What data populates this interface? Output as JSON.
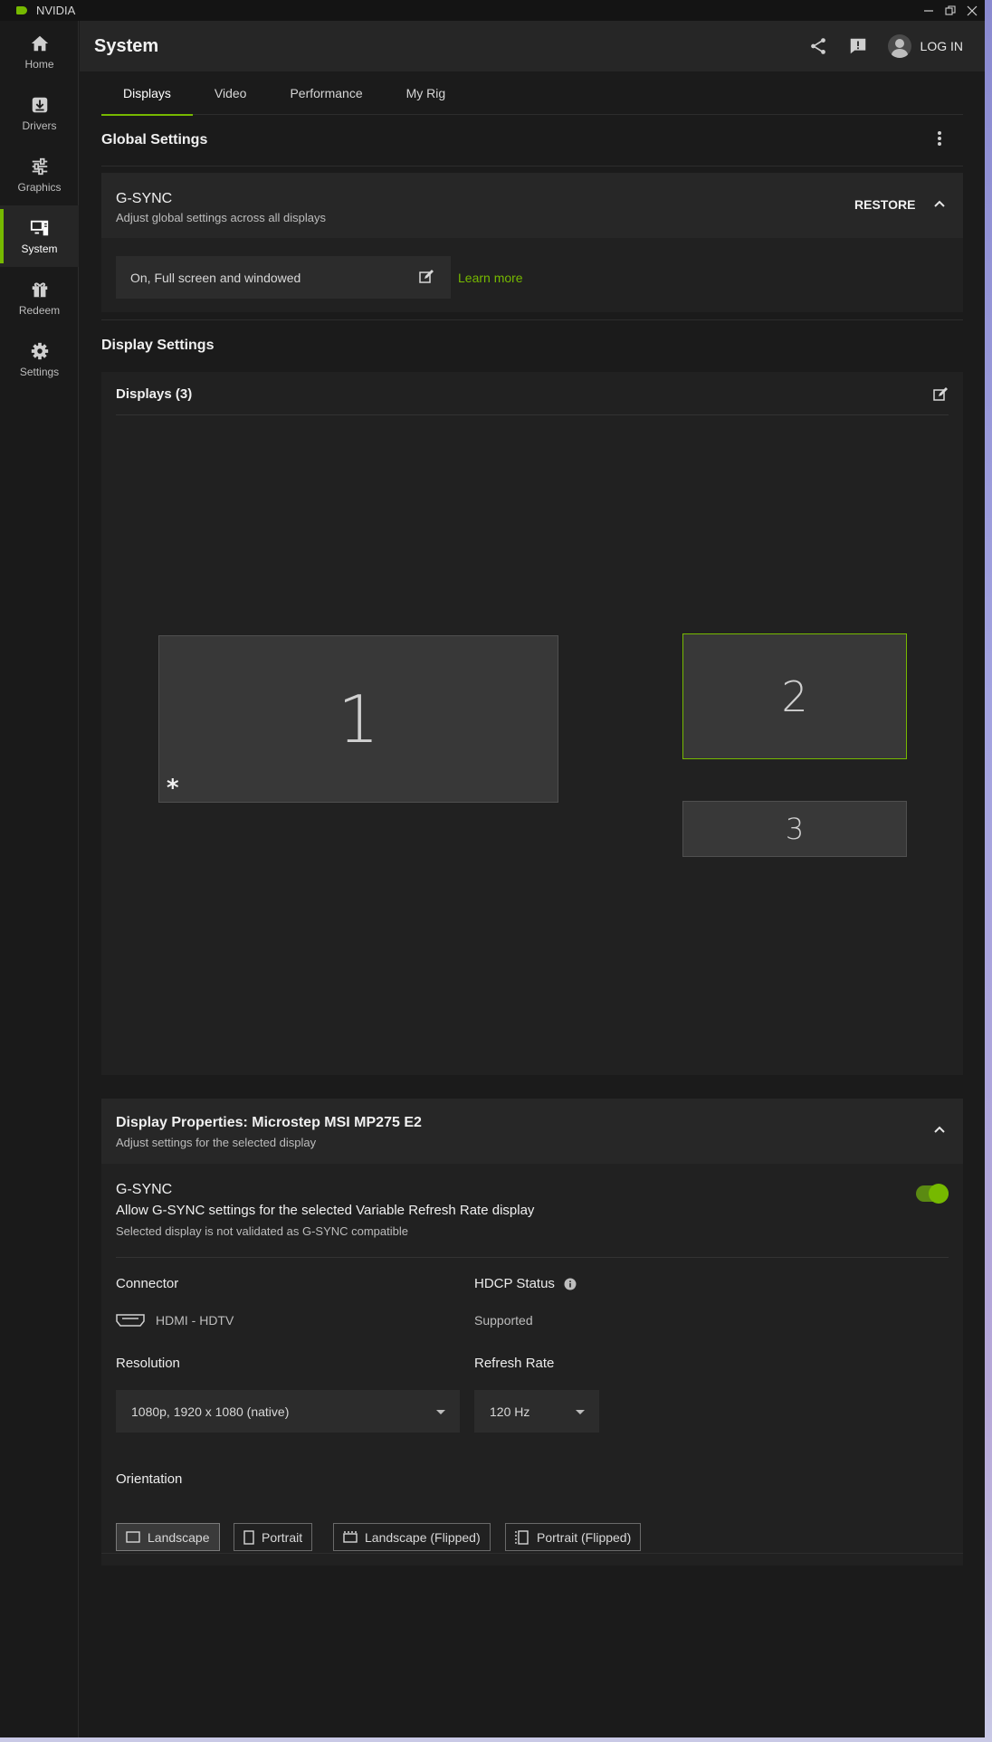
{
  "app": {
    "name": "NVIDIA"
  },
  "window_controls": [
    "minimize",
    "restore",
    "close"
  ],
  "sidebar": {
    "items": [
      {
        "label": "Home",
        "icon": "home-icon"
      },
      {
        "label": "Drivers",
        "icon": "download-icon"
      },
      {
        "label": "Graphics",
        "icon": "sliders-icon"
      },
      {
        "label": "System",
        "icon": "system-icon",
        "active": true
      },
      {
        "label": "Redeem",
        "icon": "gift-icon"
      },
      {
        "label": "Settings",
        "icon": "gear-icon"
      }
    ]
  },
  "header": {
    "title": "System",
    "login_label": "LOG IN"
  },
  "tabs": [
    {
      "label": "Displays",
      "active": true
    },
    {
      "label": "Video"
    },
    {
      "label": "Performance"
    },
    {
      "label": "My Rig"
    }
  ],
  "global": {
    "title": "Global Settings",
    "gsync": {
      "title": "G-SYNC",
      "subtitle": "Adjust global settings across all displays",
      "restore_label": "RESTORE",
      "value": "On, Full screen and windowed",
      "learn_more": "Learn more"
    }
  },
  "display_settings": {
    "title": "Display Settings",
    "displays_label": "Displays (3)",
    "monitors": [
      {
        "label": "1",
        "primary_marker": "*"
      },
      {
        "label": "2",
        "selected": true
      },
      {
        "label": "3"
      }
    ]
  },
  "props": {
    "title": "Display Properties: Microstep MSI MP275 E2",
    "subtitle": "Adjust settings for the selected display",
    "gsync": {
      "title": "G-SYNC",
      "desc": "Allow G-SYNC settings for the selected Variable Refresh Rate display",
      "note": "Selected display is not validated as G-SYNC compatible",
      "enabled": true
    },
    "connector": {
      "label": "Connector",
      "value": "HDMI - HDTV"
    },
    "hdcp": {
      "label": "HDCP Status",
      "value": "Supported"
    },
    "resolution": {
      "label": "Resolution",
      "value": "1080p, 1920 x 1080 (native)"
    },
    "refresh": {
      "label": "Refresh Rate",
      "value": "120 Hz"
    },
    "orientation": {
      "label": "Orientation",
      "options": [
        {
          "label": "Landscape",
          "active": true
        },
        {
          "label": "Portrait"
        },
        {
          "label": "Landscape (Flipped)"
        },
        {
          "label": "Portrait (Flipped)"
        }
      ]
    }
  },
  "colors": {
    "accent": "#76b900",
    "background": "#1b1b1b",
    "panel": "#212121"
  }
}
